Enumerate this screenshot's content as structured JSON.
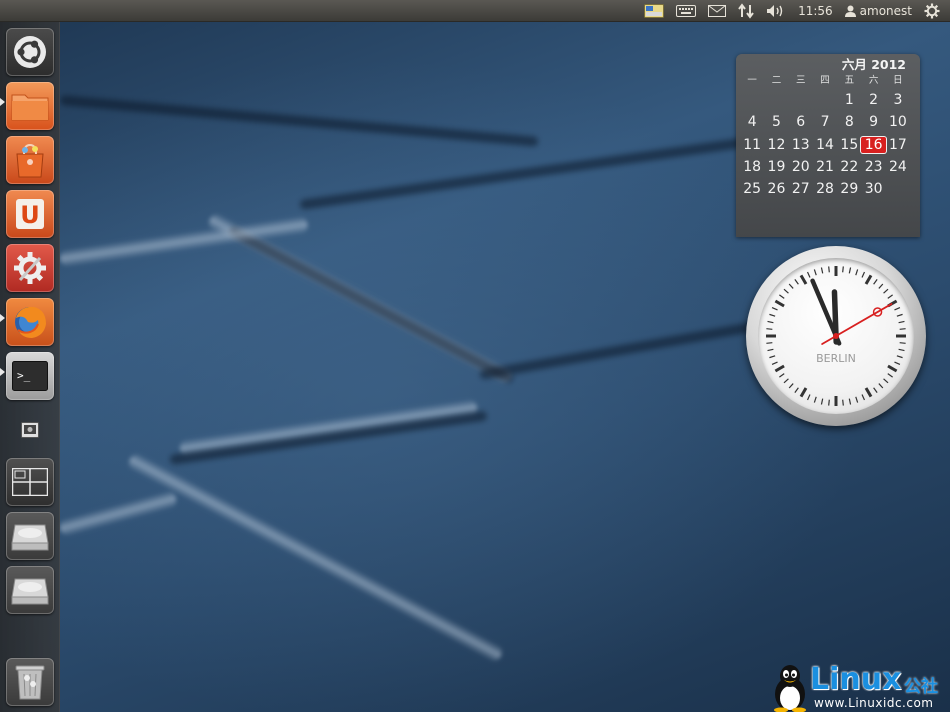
{
  "top_panel": {
    "tray_icons": [
      "indicator-applet-icon",
      "keyboard-icon",
      "mail-icon",
      "network-icon",
      "volume-icon"
    ],
    "clock": "11:56",
    "user": "amonest",
    "session_icon": "gear-icon"
  },
  "launcher": {
    "items": [
      {
        "name": "dash-home",
        "icon": "ubuntu-logo-icon"
      },
      {
        "name": "home-folder",
        "icon": "folder-icon",
        "running": true
      },
      {
        "name": "software-center",
        "icon": "shopping-bag-icon"
      },
      {
        "name": "ubuntu-one",
        "icon": "ubuntu-one-icon",
        "label": "U"
      },
      {
        "name": "system-settings",
        "icon": "settings-icon"
      },
      {
        "name": "firefox",
        "icon": "firefox-icon",
        "running": true
      },
      {
        "name": "terminal",
        "icon": "terminal-icon",
        "running": true,
        "label": ">_"
      },
      {
        "name": "screenshot",
        "icon": "screenshot-icon"
      },
      {
        "name": "workspace-switcher",
        "icon": "workspace-icon"
      },
      {
        "name": "drive-1",
        "icon": "hard-drive-icon"
      },
      {
        "name": "drive-2",
        "icon": "hard-drive-icon"
      },
      {
        "name": "trash",
        "icon": "trash-icon"
      }
    ]
  },
  "calendar": {
    "month_year": "六月 2012",
    "weekdays": [
      "一",
      "二",
      "三",
      "四",
      "五",
      "六",
      "日"
    ],
    "weeks": [
      [
        "",
        "",
        "",
        "",
        "1",
        "2",
        "3"
      ],
      [
        "4",
        "5",
        "6",
        "7",
        "8",
        "9",
        "10"
      ],
      [
        "11",
        "12",
        "13",
        "14",
        "15",
        "16",
        "17"
      ],
      [
        "18",
        "19",
        "20",
        "21",
        "22",
        "23",
        "24"
      ],
      [
        "25",
        "26",
        "27",
        "28",
        "29",
        "30",
        ""
      ]
    ],
    "today": "16",
    "today_color": "#d8201f"
  },
  "clock_widget": {
    "city": "BERLIN",
    "hour": 11,
    "minute": 56,
    "second": 10,
    "second_hand_color": "#d82020"
  },
  "watermark": {
    "brand": "Linux",
    "brand_cn": "公社",
    "url": "www.Linuxidc.com",
    "color": "#1a8fe0"
  }
}
